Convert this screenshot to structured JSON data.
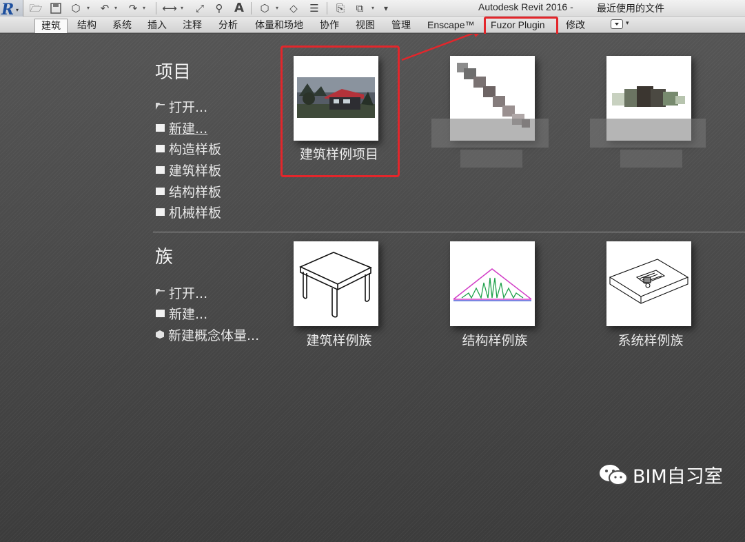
{
  "window": {
    "title": "Autodesk Revit 2016 -",
    "recent_files": "最近使用的文件",
    "app_button_icon": "revit-r-icon"
  },
  "quick_access": [
    {
      "name": "open-icon",
      "glyph": "🗁"
    },
    {
      "name": "save-icon",
      "glyph": "💾"
    },
    {
      "name": "sync-icon",
      "glyph": "⬡"
    },
    {
      "name": "undo-icon",
      "glyph": "↶"
    },
    {
      "name": "redo-icon",
      "glyph": "↷"
    },
    {
      "name": "measure-icon",
      "glyph": "⟷"
    },
    {
      "name": "dimension-icon",
      "glyph": "⤢"
    },
    {
      "name": "tag-icon",
      "glyph": "⚲"
    },
    {
      "name": "text-icon",
      "glyph": "A"
    },
    {
      "name": "3d-view-icon",
      "glyph": "⬡"
    },
    {
      "name": "section-icon",
      "glyph": "◇"
    },
    {
      "name": "thin-lines-icon",
      "glyph": "☰"
    },
    {
      "name": "close-hidden-icon",
      "glyph": "⎘"
    },
    {
      "name": "switch-windows-icon",
      "glyph": "⧉"
    },
    {
      "name": "customize-icon",
      "glyph": "▾"
    }
  ],
  "ribbon": {
    "tabs": [
      "建筑",
      "结构",
      "系统",
      "插入",
      "注释",
      "分析",
      "体量和场地",
      "协作",
      "视图",
      "管理",
      "Enscape™",
      "Fuzor Plugin",
      "修改"
    ],
    "active_tab": "建筑",
    "highlighted_tab": "Fuzor Plugin"
  },
  "projects": {
    "title": "项目",
    "links": [
      {
        "label": "打开...",
        "icon": "folder-open-icon"
      },
      {
        "label": "新建...",
        "icon": "new-document-icon"
      },
      {
        "label": "构造样板",
        "icon": "template-icon"
      },
      {
        "label": "建筑样板",
        "icon": "template-icon"
      },
      {
        "label": "结构样板",
        "icon": "template-icon"
      },
      {
        "label": "机械样板",
        "icon": "template-icon"
      }
    ],
    "recent": [
      {
        "label": "建筑样例项目",
        "thumb": "building-render-thumbnail",
        "highlighted": true
      },
      {
        "label": "",
        "thumb": "pixelated-thumbnail"
      },
      {
        "label": "",
        "thumb": "pixelated-thumbnail"
      }
    ]
  },
  "families": {
    "title": "族",
    "links": [
      {
        "label": "打开...",
        "icon": "folder-open-icon"
      },
      {
        "label": "新建...",
        "icon": "new-document-icon"
      },
      {
        "label": "新建概念体量...",
        "icon": "conceptual-mass-icon"
      }
    ],
    "recent": [
      {
        "label": "建筑样例族",
        "thumb": "table-thumbnail"
      },
      {
        "label": "结构样例族",
        "thumb": "truss-thumbnail"
      },
      {
        "label": "系统样例族",
        "thumb": "fixture-thumbnail"
      }
    ]
  },
  "watermark": {
    "text": "BIM自习室",
    "icon": "wechat-icon"
  },
  "colors": {
    "highlight_red": "#e3262b",
    "background": "#4b4b4b",
    "revit_blue": "#1d4f9e"
  }
}
